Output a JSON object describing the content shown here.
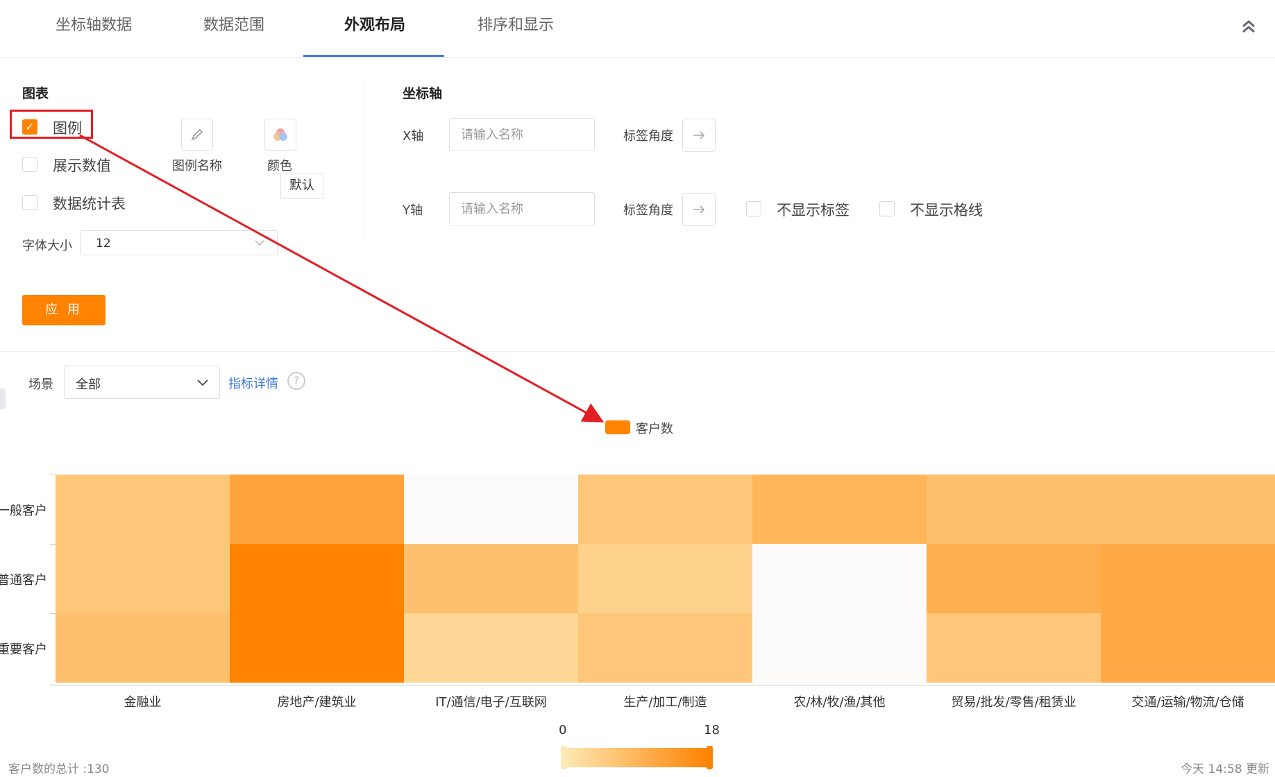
{
  "tabs": [
    {
      "label": "坐标轴数据",
      "active": false
    },
    {
      "label": "数据范围",
      "active": false
    },
    {
      "label": "外观布局",
      "active": true
    },
    {
      "label": "排序和显示",
      "active": false
    }
  ],
  "chart_panel": {
    "title": "图表",
    "legend_checkbox": {
      "label": "图例",
      "checked": true
    },
    "show_values_checkbox": {
      "label": "展示数值",
      "checked": false
    },
    "stats_table_checkbox": {
      "label": "数据统计表",
      "checked": false
    },
    "legend_name_label": "图例名称",
    "color_label": "颜色",
    "color_tooltip": "默认",
    "font_size_label": "字体大小",
    "font_size_value": "12",
    "apply_label": "应 用"
  },
  "axis_panel": {
    "title": "坐标轴",
    "x_axis_label": "X轴",
    "x_axis_placeholder": "请输入名称",
    "x_angle_label": "标签角度",
    "y_axis_label": "Y轴",
    "y_axis_placeholder": "请输入名称",
    "y_angle_label": "标签角度",
    "hide_labels_label": "不显示标签",
    "hide_gridlines_label": "不显示格线"
  },
  "filter": {
    "scene_label": "场景",
    "scene_value": "全部",
    "metric_detail_link": "指标详情"
  },
  "colors": {
    "accent": "#ff8200",
    "tab_underline": "#3c7be0",
    "annotation": "#e31e24"
  },
  "chart_data": {
    "type": "heatmap",
    "legend": [
      "客户数"
    ],
    "x_categories": [
      "金融业",
      "房地产/建筑业",
      "IT/通信/电子/互联网",
      "生产/加工/制造",
      "农/林/牧/渔/其他",
      "贸易/批发/零售/租赁业",
      "交通/运输/物流/仓储"
    ],
    "y_categories": [
      "一般客户",
      "普通客户",
      "重要客户"
    ],
    "values": [
      [
        6,
        12,
        0,
        6,
        9,
        7,
        7
      ],
      [
        6,
        18,
        7,
        4,
        0,
        10,
        11
      ],
      [
        7,
        18,
        3,
        6,
        0,
        6,
        11
      ]
    ],
    "visual_map": {
      "min": 0,
      "max": 18,
      "min_label": "0",
      "max_label": "18"
    }
  },
  "footer": {
    "total_text": "客户数的总计 :130",
    "update_text": "今天 14:58 更新"
  }
}
